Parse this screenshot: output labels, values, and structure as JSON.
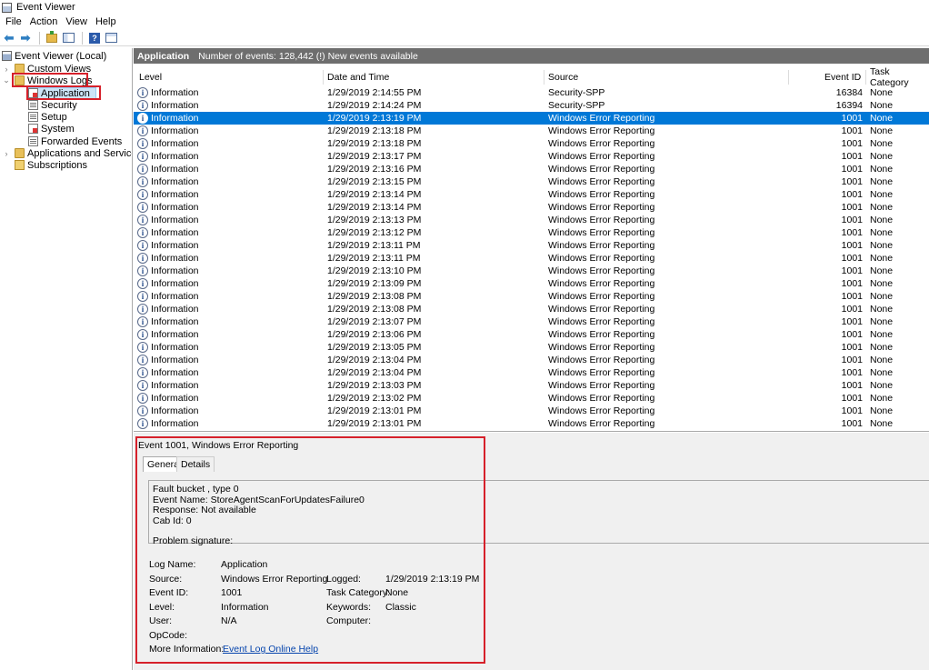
{
  "window": {
    "title": "Event Viewer"
  },
  "menu": [
    "File",
    "Action",
    "View",
    "Help"
  ],
  "tree": {
    "root": "Event Viewer (Local)",
    "custom_views": "Custom Views",
    "windows_logs": "Windows Logs",
    "logs": [
      "Application",
      "Security",
      "Setup",
      "System",
      "Forwarded Events"
    ],
    "apps_services": "Applications and Services Lo",
    "subscriptions": "Subscriptions"
  },
  "header": {
    "name": "Application",
    "info": "Number of events: 128,442 (!) New events available"
  },
  "columns": {
    "level": "Level",
    "datetime": "Date and Time",
    "source": "Source",
    "event_id": "Event ID",
    "task": "Task Category"
  },
  "rows": [
    {
      "level": "Information",
      "datetime": "1/29/2019 2:14:55 PM",
      "source": "Security-SPP",
      "id": "16384",
      "task": "None"
    },
    {
      "level": "Information",
      "datetime": "1/29/2019 2:14:24 PM",
      "source": "Security-SPP",
      "id": "16394",
      "task": "None"
    },
    {
      "level": "Information",
      "datetime": "1/29/2019 2:13:19 PM",
      "source": "Windows Error Reporting",
      "id": "1001",
      "task": "None"
    },
    {
      "level": "Information",
      "datetime": "1/29/2019 2:13:18 PM",
      "source": "Windows Error Reporting",
      "id": "1001",
      "task": "None"
    },
    {
      "level": "Information",
      "datetime": "1/29/2019 2:13:18 PM",
      "source": "Windows Error Reporting",
      "id": "1001",
      "task": "None"
    },
    {
      "level": "Information",
      "datetime": "1/29/2019 2:13:17 PM",
      "source": "Windows Error Reporting",
      "id": "1001",
      "task": "None"
    },
    {
      "level": "Information",
      "datetime": "1/29/2019 2:13:16 PM",
      "source": "Windows Error Reporting",
      "id": "1001",
      "task": "None"
    },
    {
      "level": "Information",
      "datetime": "1/29/2019 2:13:15 PM",
      "source": "Windows Error Reporting",
      "id": "1001",
      "task": "None"
    },
    {
      "level": "Information",
      "datetime": "1/29/2019 2:13:14 PM",
      "source": "Windows Error Reporting",
      "id": "1001",
      "task": "None"
    },
    {
      "level": "Information",
      "datetime": "1/29/2019 2:13:14 PM",
      "source": "Windows Error Reporting",
      "id": "1001",
      "task": "None"
    },
    {
      "level": "Information",
      "datetime": "1/29/2019 2:13:13 PM",
      "source": "Windows Error Reporting",
      "id": "1001",
      "task": "None"
    },
    {
      "level": "Information",
      "datetime": "1/29/2019 2:13:12 PM",
      "source": "Windows Error Reporting",
      "id": "1001",
      "task": "None"
    },
    {
      "level": "Information",
      "datetime": "1/29/2019 2:13:11 PM",
      "source": "Windows Error Reporting",
      "id": "1001",
      "task": "None"
    },
    {
      "level": "Information",
      "datetime": "1/29/2019 2:13:11 PM",
      "source": "Windows Error Reporting",
      "id": "1001",
      "task": "None"
    },
    {
      "level": "Information",
      "datetime": "1/29/2019 2:13:10 PM",
      "source": "Windows Error Reporting",
      "id": "1001",
      "task": "None"
    },
    {
      "level": "Information",
      "datetime": "1/29/2019 2:13:09 PM",
      "source": "Windows Error Reporting",
      "id": "1001",
      "task": "None"
    },
    {
      "level": "Information",
      "datetime": "1/29/2019 2:13:08 PM",
      "source": "Windows Error Reporting",
      "id": "1001",
      "task": "None"
    },
    {
      "level": "Information",
      "datetime": "1/29/2019 2:13:08 PM",
      "source": "Windows Error Reporting",
      "id": "1001",
      "task": "None"
    },
    {
      "level": "Information",
      "datetime": "1/29/2019 2:13:07 PM",
      "source": "Windows Error Reporting",
      "id": "1001",
      "task": "None"
    },
    {
      "level": "Information",
      "datetime": "1/29/2019 2:13:06 PM",
      "source": "Windows Error Reporting",
      "id": "1001",
      "task": "None"
    },
    {
      "level": "Information",
      "datetime": "1/29/2019 2:13:05 PM",
      "source": "Windows Error Reporting",
      "id": "1001",
      "task": "None"
    },
    {
      "level": "Information",
      "datetime": "1/29/2019 2:13:04 PM",
      "source": "Windows Error Reporting",
      "id": "1001",
      "task": "None"
    },
    {
      "level": "Information",
      "datetime": "1/29/2019 2:13:04 PM",
      "source": "Windows Error Reporting",
      "id": "1001",
      "task": "None"
    },
    {
      "level": "Information",
      "datetime": "1/29/2019 2:13:03 PM",
      "source": "Windows Error Reporting",
      "id": "1001",
      "task": "None"
    },
    {
      "level": "Information",
      "datetime": "1/29/2019 2:13:02 PM",
      "source": "Windows Error Reporting",
      "id": "1001",
      "task": "None"
    },
    {
      "level": "Information",
      "datetime": "1/29/2019 2:13:01 PM",
      "source": "Windows Error Reporting",
      "id": "1001",
      "task": "None"
    },
    {
      "level": "Information",
      "datetime": "1/29/2019 2:13:01 PM",
      "source": "Windows Error Reporting",
      "id": "1001",
      "task": "None"
    }
  ],
  "selected_row": 2,
  "detail": {
    "title": "Event 1001, Windows Error Reporting",
    "tabs": [
      "General",
      "Details"
    ],
    "description": [
      "Fault bucket , type 0",
      "Event Name: StoreAgentScanForUpdatesFailure0",
      "Response: Not available",
      "Cab Id: 0",
      "",
      "Problem signature:"
    ],
    "labels": {
      "log_name": "Log Name:",
      "source": "Source:",
      "event_id": "Event ID:",
      "level": "Level:",
      "user": "User:",
      "opcode": "OpCode:",
      "more_info": "More Information:",
      "logged": "Logged:",
      "task_category": "Task Category:",
      "keywords": "Keywords:",
      "computer": "Computer:"
    },
    "values": {
      "log_name": "Application",
      "source": "Windows Error Reporting",
      "event_id": "1001",
      "level": "Information",
      "user": "N/A",
      "logged": "1/29/2019 2:13:19 PM",
      "task_category": "None",
      "keywords": "Classic",
      "link": "Event Log Online Help"
    }
  },
  "colors": {
    "selection": "#0078d7",
    "highlight_box": "#d6202a",
    "header_bar": "#6e6e6e"
  }
}
